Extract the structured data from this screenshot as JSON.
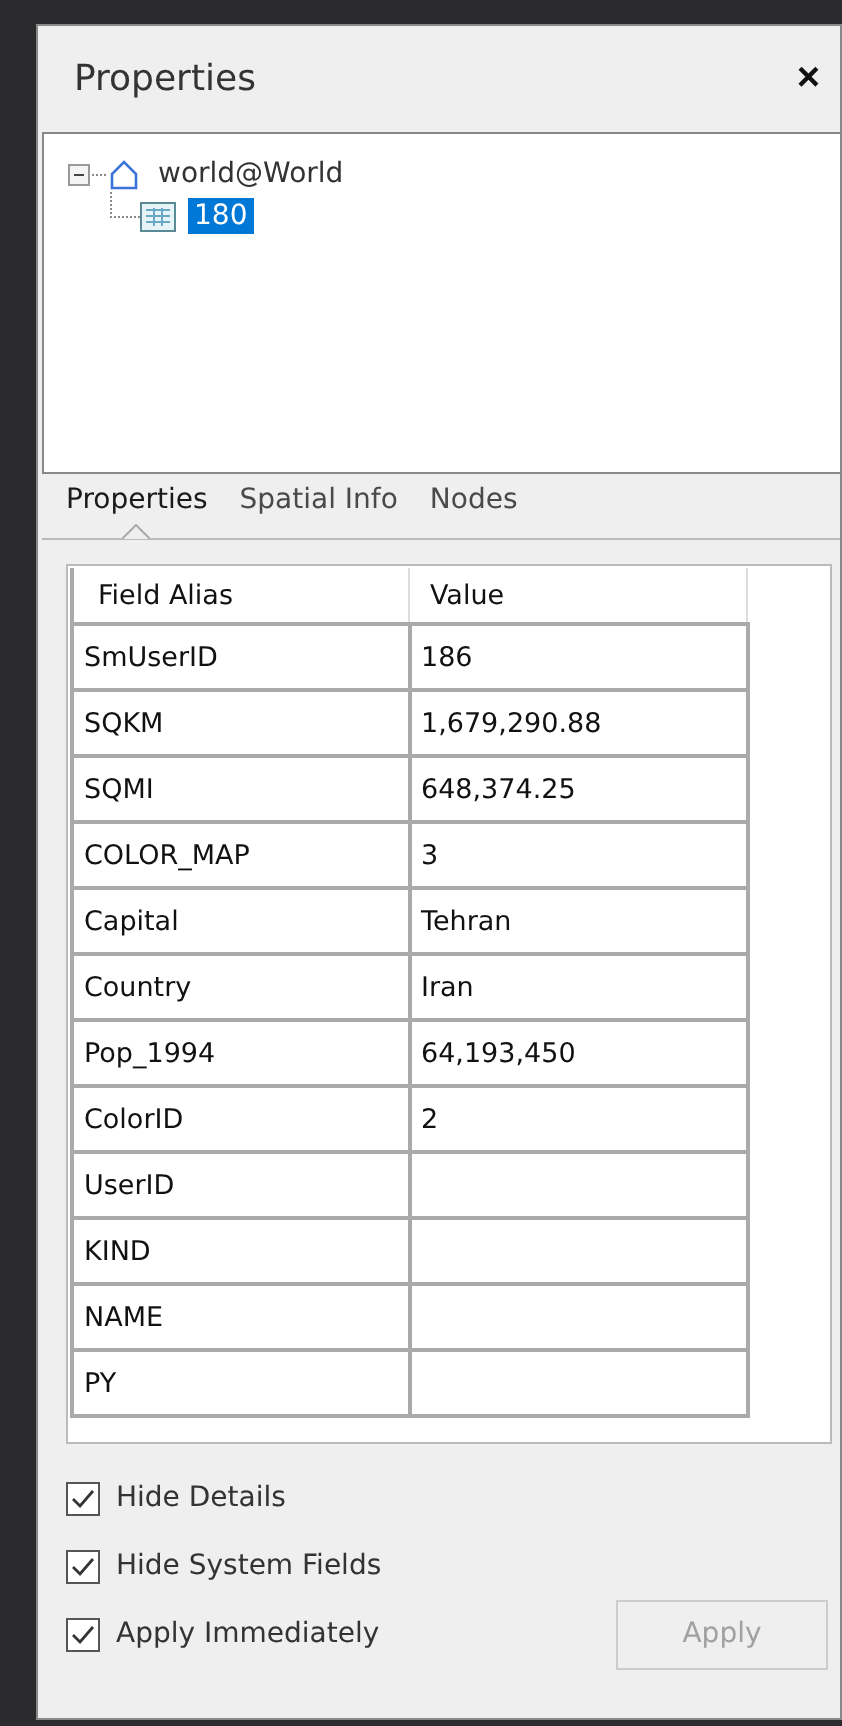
{
  "window": {
    "title": "Properties",
    "close": "×"
  },
  "tree": [
    {
      "label": "world@World",
      "expanded": true,
      "selected": false,
      "children": [
        {
          "label": "180",
          "selected": true
        }
      ]
    }
  ],
  "tabs": [
    {
      "label": "Properties",
      "selected": true
    },
    {
      "label": "Spatial Info",
      "selected": false
    },
    {
      "label": "Nodes",
      "selected": false
    }
  ],
  "table": {
    "columns": [
      "Field Alias",
      "Value"
    ],
    "rows": [
      [
        "SmUserID",
        "186"
      ],
      [
        "SQKM",
        "1,679,290.88"
      ],
      [
        "SQMI",
        "648,374.25"
      ],
      [
        "COLOR_MAP",
        "3"
      ],
      [
        "Capital",
        "Tehran"
      ],
      [
        "Country",
        "Iran"
      ],
      [
        "Pop_1994",
        "64,193,450"
      ],
      [
        "ColorID",
        "2"
      ],
      [
        "UserID",
        ""
      ],
      [
        "KIND",
        ""
      ],
      [
        "NAME",
        ""
      ],
      [
        "PY",
        ""
      ]
    ]
  },
  "options": [
    {
      "label": "Hide Details",
      "checked": true
    },
    {
      "label": "Hide System Fields",
      "checked": true
    },
    {
      "label": "Apply Immediately",
      "checked": true
    }
  ],
  "apply_button": {
    "label": "Apply",
    "disabled": true
  }
}
